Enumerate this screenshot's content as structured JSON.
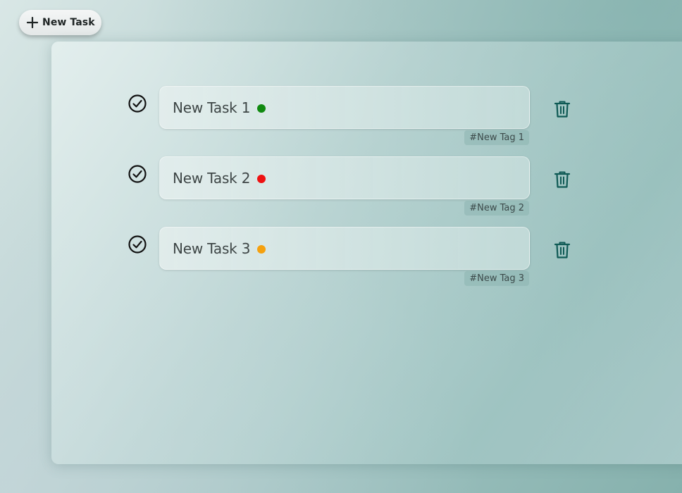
{
  "toolbar": {
    "new_task_label": "New Task",
    "new_task_icon": "plus-icon"
  },
  "tasks": [
    {
      "title": "New Task 1",
      "priority_color": "#108a10",
      "tag": "#New Tag 1",
      "complete_icon": "check-circle-icon",
      "delete_icon": "trash-icon"
    },
    {
      "title": "New Task 2",
      "priority_color": "#ee1111",
      "tag": "#New Tag 2",
      "complete_icon": "check-circle-icon",
      "delete_icon": "trash-icon"
    },
    {
      "title": "New Task 3",
      "priority_color": "#f5a10f",
      "tag": "#New Tag 3",
      "complete_icon": "check-circle-icon",
      "delete_icon": "trash-icon"
    }
  ],
  "colors": {
    "trash": "#0f5a55",
    "check": "#111111"
  }
}
